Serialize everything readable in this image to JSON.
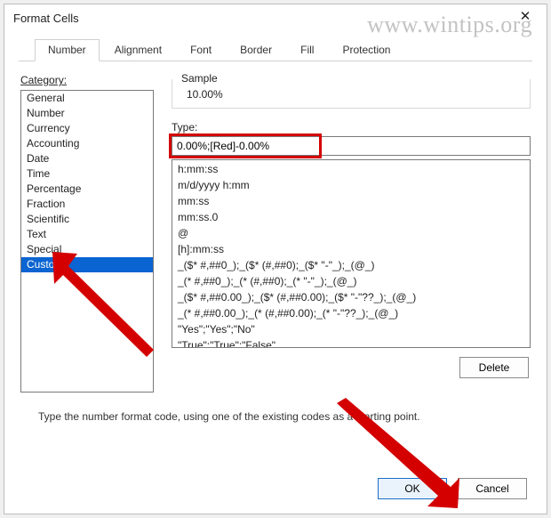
{
  "watermark": "www.wintips.org",
  "window": {
    "title": "Format Cells"
  },
  "tabs": [
    "Number",
    "Alignment",
    "Font",
    "Border",
    "Fill",
    "Protection"
  ],
  "active_tab": "Number",
  "category_label": "Category:",
  "categories": [
    "General",
    "Number",
    "Currency",
    "Accounting",
    "Date",
    "Time",
    "Percentage",
    "Fraction",
    "Scientific",
    "Text",
    "Special",
    "Custom"
  ],
  "selected_category": "Custom",
  "sample": {
    "label": "Sample",
    "value": "10.00%"
  },
  "type": {
    "label": "Type:",
    "value": "0.00%;[Red]-0.00%"
  },
  "format_codes": [
    "h:mm:ss",
    "m/d/yyyy h:mm",
    "mm:ss",
    "mm:ss.0",
    "@",
    "[h]:mm:ss",
    "_($* #,##0_);_($* (#,##0);_($* \"-\"_);_(@_)",
    "_(* #,##0_);_(* (#,##0);_(* \"-\"_);_(@_)",
    "_($* #,##0.00_);_($* (#,##0.00);_($* \"-\"??_);_(@_)",
    "_(* #,##0.00_);_(* (#,##0.00);_(* \"-\"??_);_(@_)",
    "\"Yes\";\"Yes\";\"No\"",
    "\"True\";\"True\";\"False\""
  ],
  "buttons": {
    "delete": "Delete",
    "ok": "OK",
    "cancel": "Cancel"
  },
  "hint": "Type the number format code, using one of the existing codes as a starting point."
}
